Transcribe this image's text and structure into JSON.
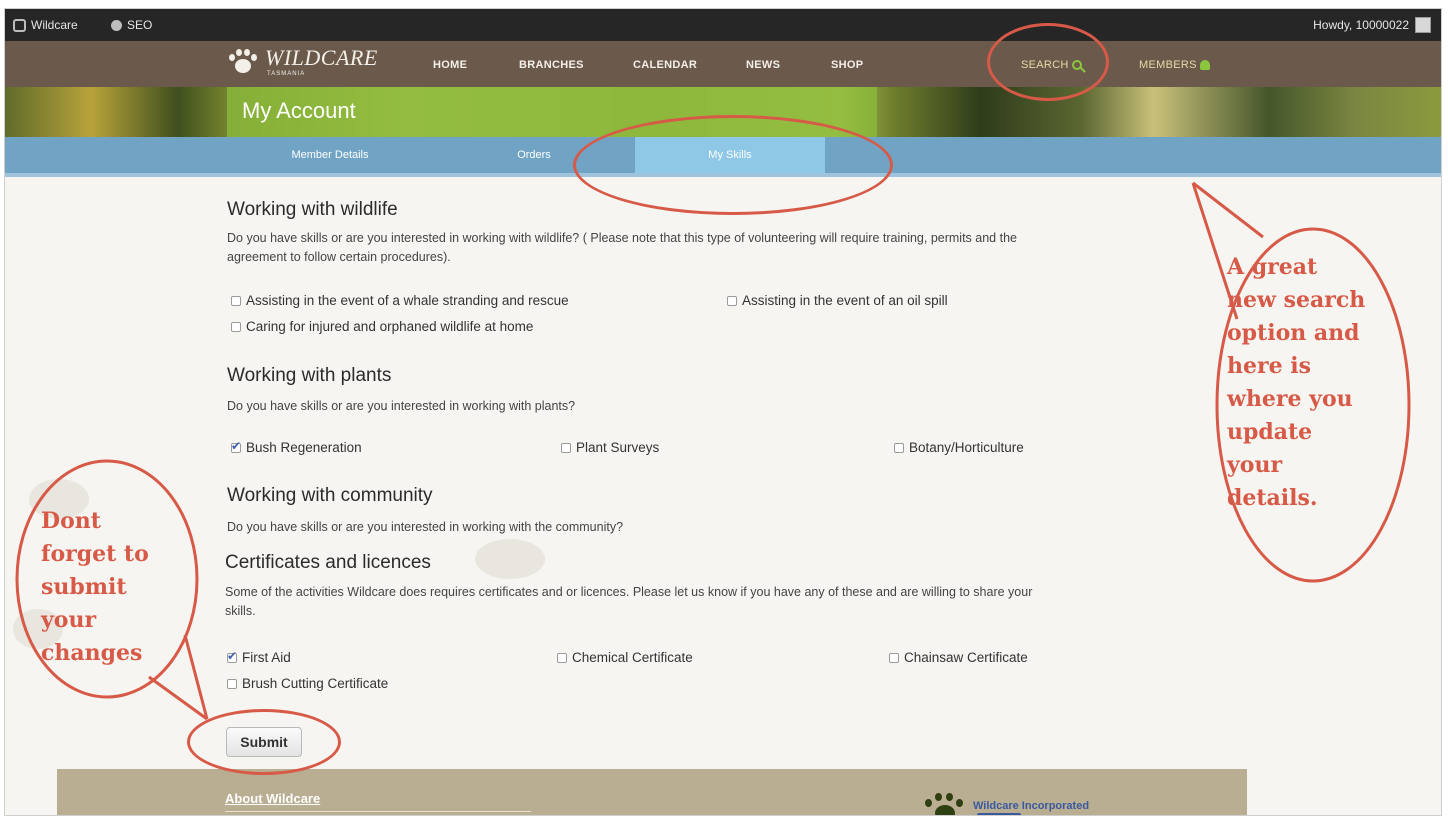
{
  "admin_bar": {
    "site_label": "Wildcare",
    "seo_label": "SEO",
    "howdy": "Howdy, 10000022"
  },
  "nav": {
    "logo_text": "WILDCARE",
    "logo_sub": "TASMANIA",
    "links": [
      "HOME",
      "BRANCHES",
      "CALENDAR",
      "NEWS",
      "SHOP"
    ],
    "search": "SEARCH",
    "members": "MEMBERS"
  },
  "banner": {
    "title": "My Account"
  },
  "tabs": [
    {
      "label": "Member Details",
      "active": false
    },
    {
      "label": "Orders",
      "active": false
    },
    {
      "label": "My Skills",
      "active": true
    }
  ],
  "sections": {
    "wildlife": {
      "title": "Working with wildlife",
      "desc_line1": "Do you have skills or are you interested in working with wildlife? ( Please note that this type of volunteering will require training, permits and the",
      "desc_line2": "agreement to follow certain procedures).",
      "options": [
        {
          "label": "Assisting in the event of a whale stranding and rescue",
          "checked": false
        },
        {
          "label": "Assisting in the event of an oil spill",
          "checked": false
        },
        {
          "label": "Caring for injured and orphaned wildlife at home",
          "checked": false
        }
      ]
    },
    "plants": {
      "title": "Working with plants",
      "desc": "Do you have skills or are you interested in working with plants?",
      "options": [
        {
          "label": "Bush Regeneration",
          "checked": true
        },
        {
          "label": "Plant Surveys",
          "checked": false
        },
        {
          "label": "Botany/Horticulture",
          "checked": false
        }
      ]
    },
    "community": {
      "title": "Working with community",
      "desc": "Do you have skills or are you interested in working with the community?"
    },
    "certificates": {
      "title": "Certificates and licences",
      "desc_line1": "Some of the activities Wildcare does requires certificates and or licences. Please let us know if you have any of these and are willing to share your",
      "desc_line2": "skills.",
      "options": [
        {
          "label": "First Aid",
          "checked": true
        },
        {
          "label": "Chemical Certificate",
          "checked": false
        },
        {
          "label": "Chainsaw Certificate",
          "checked": false
        },
        {
          "label": "Brush Cutting Certificate",
          "checked": false
        }
      ]
    }
  },
  "submit_label": "Submit",
  "footer": {
    "about": "About Wildcare",
    "org_name": "Wildcare Incorporated"
  },
  "annotations": {
    "right": [
      "A great",
      "new search",
      "option and",
      "here is",
      "where you",
      "update",
      "your",
      "details."
    ],
    "left": [
      "Dont",
      "forget to",
      "submit",
      "your",
      "changes"
    ],
    "color": "#d65a47"
  },
  "colors": {
    "nav_bg": "#6b5a4b",
    "tab_bar": "#71a4c4",
    "tab_active": "#8ec8e6",
    "admin_bar": "#262626"
  }
}
